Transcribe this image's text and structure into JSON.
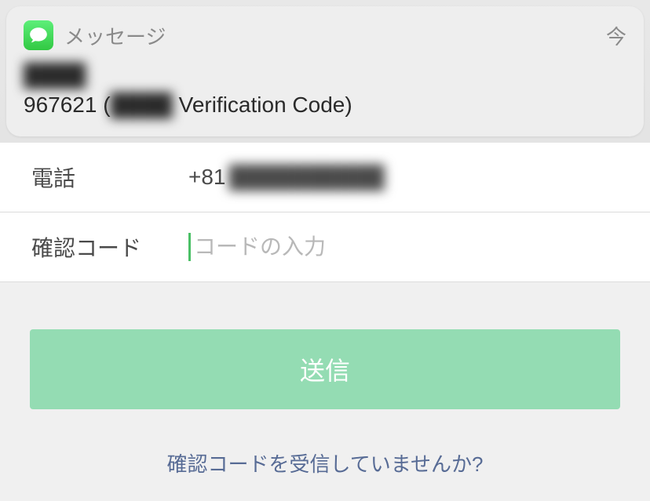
{
  "notification": {
    "app_name": "メッセージ",
    "time": "今",
    "sender": "████",
    "body_code": "967621 (",
    "body_censored": "████",
    "body_suffix": " Verification Code)"
  },
  "form": {
    "phone_label": "電話",
    "phone_prefix": "+81",
    "phone_censored": "██████████",
    "code_label": "確認コード",
    "code_placeholder": "コードの入力"
  },
  "submit_label": "送信",
  "resend_label": "確認コードを受信していませんか?"
}
